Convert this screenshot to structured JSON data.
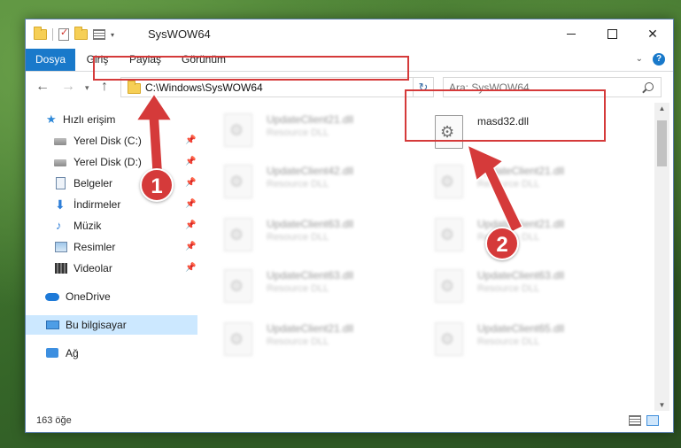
{
  "window": {
    "title": "SysWOW64",
    "controls": {
      "minimize_icon": "minimize-icon",
      "maximize_icon": "maximize-icon",
      "close_glyph": "✕"
    }
  },
  "ribbon": {
    "tabs": [
      {
        "label": "Dosya"
      },
      {
        "label": "Giriş"
      },
      {
        "label": "Paylaş"
      },
      {
        "label": "Görünüm"
      }
    ],
    "help_label": "?",
    "accent": "#1979ca"
  },
  "navbar": {
    "back_glyph": "←",
    "forward_glyph": "→",
    "recent_glyph": "▾",
    "up_glyph": "↑",
    "address": "C:\\Windows\\SysWOW64",
    "address_dropdown_glyph": "⌵",
    "refresh_glyph": "↻",
    "search_placeholder": "Ara: SysWOW64"
  },
  "sidebar": {
    "items": [
      {
        "label": "Hızlı erişim",
        "icon": "star-icon"
      },
      {
        "label": "Yerel Disk (C:)",
        "icon": "drive-icon",
        "pinned": true
      },
      {
        "label": "Yerel Disk (D:)",
        "icon": "drive-icon",
        "pinned": true
      },
      {
        "label": "Belgeler",
        "icon": "document-icon",
        "pinned": true
      },
      {
        "label": "İndirmeler",
        "icon": "download-icon",
        "pinned": true
      },
      {
        "label": "Müzik",
        "icon": "music-icon",
        "pinned": true
      },
      {
        "label": "Resimler",
        "icon": "pictures-icon",
        "pinned": true
      },
      {
        "label": "Videolar",
        "icon": "videos-icon",
        "pinned": true
      },
      {
        "label": "OneDrive",
        "icon": "onedrive-icon"
      },
      {
        "label": "Bu bilgisayar",
        "icon": "computer-icon",
        "selected": true
      },
      {
        "label": "Ağ",
        "icon": "network-icon"
      }
    ],
    "pin_glyph": "📌"
  },
  "files": {
    "left_column": [
      {
        "name": "UpdateClient21.dll",
        "type": "Resource DLL"
      },
      {
        "name": "UpdateClient42.dll",
        "type": "Resource DLL"
      },
      {
        "name": "UpdateClient63.dll",
        "type": "Resource DLL"
      },
      {
        "name": "UpdateClient63.dll",
        "type": "Resource DLL"
      },
      {
        "name": "UpdateClient21.dll",
        "type": "Resource DLL"
      }
    ],
    "right_column": [
      {
        "name": "masd32.dll",
        "type": ""
      },
      {
        "name": "UpdateClient21.dll",
        "type": "Resource DLL"
      },
      {
        "name": "UpdateClient21.dll",
        "type": "Resource DLL"
      },
      {
        "name": "UpdateClient63.dll",
        "type": "Resource DLL"
      },
      {
        "name": "UpdateClient65.dll",
        "type": "Resource DLL"
      }
    ]
  },
  "scrollbar": {
    "up_glyph": "▲",
    "down_glyph": "▼"
  },
  "status": {
    "item_count": "163 öğe"
  },
  "annotations": {
    "highlight_color": "#d53a3a",
    "callout_1": "1",
    "callout_2": "2"
  }
}
